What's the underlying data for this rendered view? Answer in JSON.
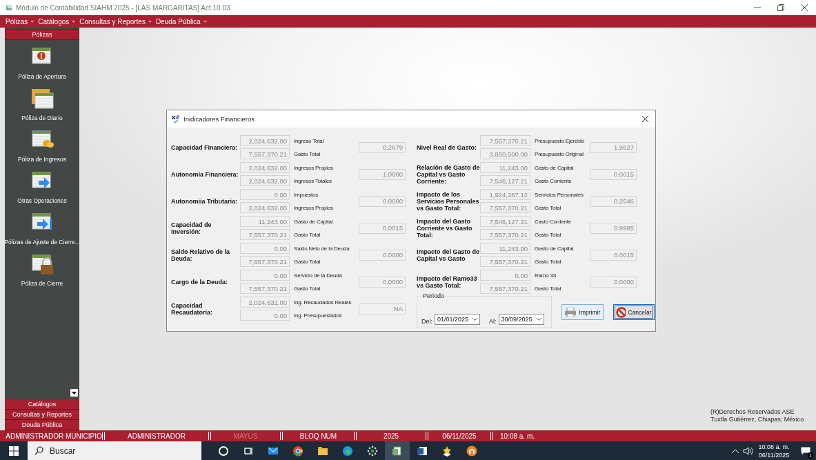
{
  "window": {
    "title": "Módulo de Contabilidad SIAHM 2025 - [LAS MARGARITAS] Act.10.03"
  },
  "menu": [
    "Pólizas",
    "Catálogos",
    "Consultas y Reportes",
    "Deuda Pública"
  ],
  "sidebar": {
    "header": "Pólizas",
    "items": [
      {
        "label": "Póliza de Apertura",
        "kind": "number"
      },
      {
        "label": "Póliza de Diario",
        "kind": "stack"
      },
      {
        "label": "Póliza de Ingresos",
        "kind": "coins"
      },
      {
        "label": "Otras Operaciones",
        "kind": "arrow"
      },
      {
        "label": "Pólizas de Ajuste de Cierre...",
        "kind": "arrowbar"
      },
      {
        "label": "Póliza de Cierre",
        "kind": "lock"
      }
    ],
    "sections": [
      "Catálogos",
      "Consultas y Reportes",
      "Deuda Pública"
    ]
  },
  "dialog": {
    "title": "Inidicadores Financieros",
    "left": [
      {
        "label": "Capacidad Financiera:",
        "rows": [
          {
            "amount": "2,024,632.00",
            "caption": "Ingreso Total"
          },
          {
            "amount": "7,557,370.21",
            "caption": "Gasto Total"
          }
        ],
        "result": "0.2679"
      },
      {
        "label": "Autonomía Financiera:",
        "rows": [
          {
            "amount": "2,024,632.00",
            "caption": "Ingresos Propios"
          },
          {
            "amount": "2,024,632.00",
            "caption": "Ingresos Totales"
          }
        ],
        "result": "1.0000"
      },
      {
        "label": "Autonomiia Tributaria:",
        "rows": [
          {
            "amount": "0.00",
            "caption": "Impuestos"
          },
          {
            "amount": "2,024,632.00",
            "caption": "Ingresos Propios"
          }
        ],
        "result": "0.0000"
      },
      {
        "label": "Capacidad de Inversión:",
        "rows": [
          {
            "amount": "11,243.00",
            "caption": "Gasto de Capital"
          },
          {
            "amount": "7,557,370.21",
            "caption": "Gasto Total"
          }
        ],
        "result": "0.0015"
      },
      {
        "label": "Saldo Relativo de la Deuda:",
        "rows": [
          {
            "amount": "0.00",
            "caption": "Saldo Neto de la Deuda"
          },
          {
            "amount": "7,557,370.21",
            "caption": "Gasto Total"
          }
        ],
        "result": "0.0000"
      },
      {
        "label": "Cargo de la Deuda:",
        "rows": [
          {
            "amount": "0.00",
            "caption": "Servicio de la Deuda"
          },
          {
            "amount": "7,557,370.21",
            "caption": "Gasto Total"
          }
        ],
        "result": "0.0000"
      },
      {
        "label": "Capacidad Recaudatoria:",
        "rows": [
          {
            "amount": "2,024,632.00",
            "caption": "Ing. Recaudados Reales"
          },
          {
            "amount": "0.00",
            "caption": "Ing. Presupuestados"
          }
        ],
        "result": "NA"
      }
    ],
    "right": [
      {
        "label": "Nivel Real de Gasto:",
        "rows": [
          {
            "amount": "7,557,370.21",
            "caption": "Presupuesto Ejercido"
          },
          {
            "amount": "3,850,500.00",
            "caption": "Presupuesto Original"
          }
        ],
        "result": "1.9627"
      },
      {
        "label": "Relación de Gasto de Capital vs Gasto Corriente:",
        "rows": [
          {
            "amount": "11,243.00",
            "caption": "Gasto de Capital"
          },
          {
            "amount": "7,546,127.21",
            "caption": "Gasto Corriente"
          }
        ],
        "result": "0.0015"
      },
      {
        "label": "Impacto de los Servicios Personales vs Gasto Total:",
        "rows": [
          {
            "amount": "1,924,287.12",
            "caption": "Servicios Personales"
          },
          {
            "amount": "7,557,370.21",
            "caption": "Gasto Total"
          }
        ],
        "result": "0.2546"
      },
      {
        "label": "Impacto del Gasto Corriente vs Gasto Total:",
        "rows": [
          {
            "amount": "7,546,127.21",
            "caption": "Casto Corriente"
          },
          {
            "amount": "7,557,370.21",
            "caption": "Gasto Total"
          }
        ],
        "result": "0.9985"
      },
      {
        "label": "Impacto del Gasto de Capital vs Gasto",
        "rows": [
          {
            "amount": "11,243.00",
            "caption": "Gasto de Capital"
          },
          {
            "amount": "7,557,370.21",
            "caption": "Gasto Total"
          }
        ],
        "result": "0.0015"
      },
      {
        "label": "Impacto del Ramo33 vs Gasto Total:",
        "rows": [
          {
            "amount": "0.00",
            "caption": "Ramo 33"
          },
          {
            "amount": "7,557,370.21",
            "caption": "Gasto Total"
          }
        ],
        "result": "0.0000"
      }
    ],
    "period": {
      "legend": "Periodo",
      "from_label": "Del:",
      "from": "01/01/2025",
      "to_label": "Al:",
      "to": "30/09/2025"
    },
    "buttons": [
      {
        "label": "Imprimir",
        "kind": "print"
      },
      {
        "label": "Cancelar",
        "kind": "cancel"
      }
    ]
  },
  "copyright": [
    "(R)Derechos Reservados ASE",
    "Tuxtla Gutiérrez, Chiapas; México"
  ],
  "status_bar": [
    {
      "text": "ADMINISTRADOR MUNICIPIO",
      "disabled": false
    },
    {
      "text": "ADMINISTRADOR",
      "disabled": false
    },
    {
      "text": "MAYUS",
      "disabled": true
    },
    {
      "text": "BLOQ NUM",
      "disabled": false
    },
    {
      "text": "2025",
      "disabled": false
    },
    {
      "text": "06/11/2025",
      "disabled": false
    },
    {
      "text": "10:08 a. m.",
      "disabled": false
    }
  ],
  "taskbar": {
    "search": {
      "placeholder": "Buscar"
    },
    "apps": [
      {
        "kind": "circle",
        "active": false
      },
      {
        "kind": "taskview",
        "active": false
      },
      {
        "kind": "mail",
        "active": false
      },
      {
        "kind": "browser",
        "active": false
      },
      {
        "kind": "folder",
        "active": false
      },
      {
        "kind": "wave",
        "active": false
      },
      {
        "kind": "dots",
        "active": false
      },
      {
        "kind": "sheet",
        "active": true
      },
      {
        "kind": "doc",
        "active": false
      },
      {
        "kind": "star",
        "active": false
      },
      {
        "kind": "orb",
        "active": false
      }
    ],
    "time": "10:08 a. m.",
    "date": "06/11/2025",
    "notifications": "1"
  }
}
